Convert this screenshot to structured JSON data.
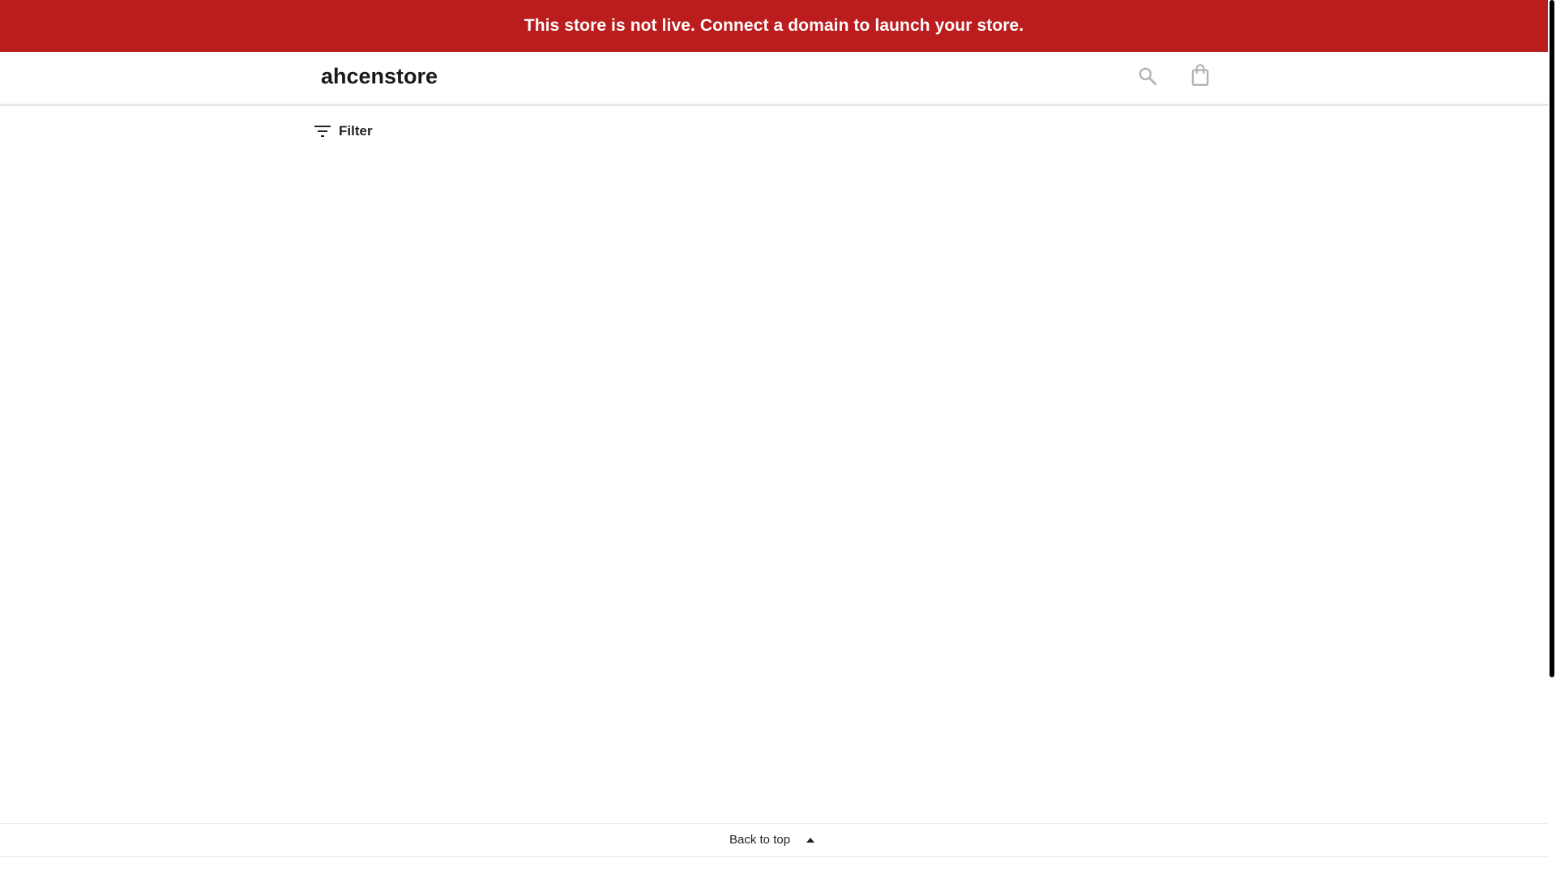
{
  "announcement": {
    "text": "This store is not live. Connect a domain to launch your store.",
    "background_color": "#bb1c1e",
    "text_color": "#ffffff"
  },
  "header": {
    "store_name": "ahcenstore",
    "search_icon": "search-icon",
    "cart_icon": "shopping-bag-icon"
  },
  "toolbar": {
    "filter_label": "Filter",
    "filter_icon": "filter-icon"
  },
  "footer": {
    "back_to_top_label": "Back to top",
    "back_to_top_icon": "caret-up-icon"
  }
}
